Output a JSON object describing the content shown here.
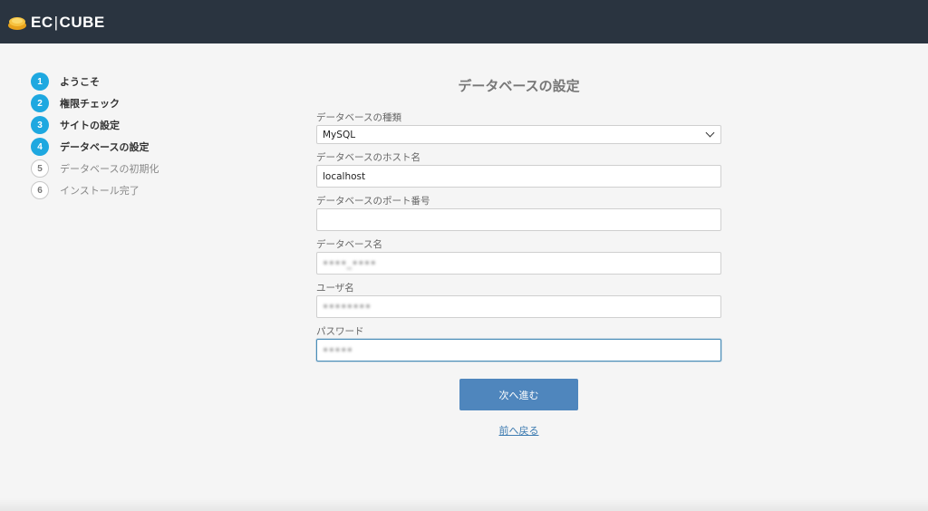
{
  "header": {
    "logo": {
      "part1": "EC",
      "separator": "|",
      "part2": "CUBE",
      "icon": "ec-cube-logo-icon"
    },
    "bg_color": "#2a3440"
  },
  "steps": [
    {
      "num": "1",
      "label": "ようこそ",
      "state": "done"
    },
    {
      "num": "2",
      "label": "権限チェック",
      "state": "done"
    },
    {
      "num": "3",
      "label": "サイトの設定",
      "state": "done"
    },
    {
      "num": "4",
      "label": "データベースの設定",
      "state": "current"
    },
    {
      "num": "5",
      "label": "データベースの初期化",
      "state": "todo"
    },
    {
      "num": "6",
      "label": "インストール完了",
      "state": "todo"
    }
  ],
  "form": {
    "title": "データベースの設定",
    "db_type": {
      "label": "データベースの種類",
      "value": "MySQL",
      "icon": "chevron-down-icon"
    },
    "host": {
      "label": "データベースのホスト名",
      "value": "localhost"
    },
    "port": {
      "label": "データベースのポート番号",
      "value": ""
    },
    "db_name": {
      "label": "データベース名",
      "value": "••••_••••"
    },
    "user": {
      "label": "ユーザ名",
      "value": "••••••••"
    },
    "password": {
      "label": "パスワード",
      "value": "•••••"
    },
    "next_button": "次へ進む",
    "back_link": "前へ戻る"
  },
  "colors": {
    "accent": "#1ea8e0",
    "button": "#4f86bd",
    "link": "#3e7cb1",
    "focus_border": "#4a8db8"
  }
}
